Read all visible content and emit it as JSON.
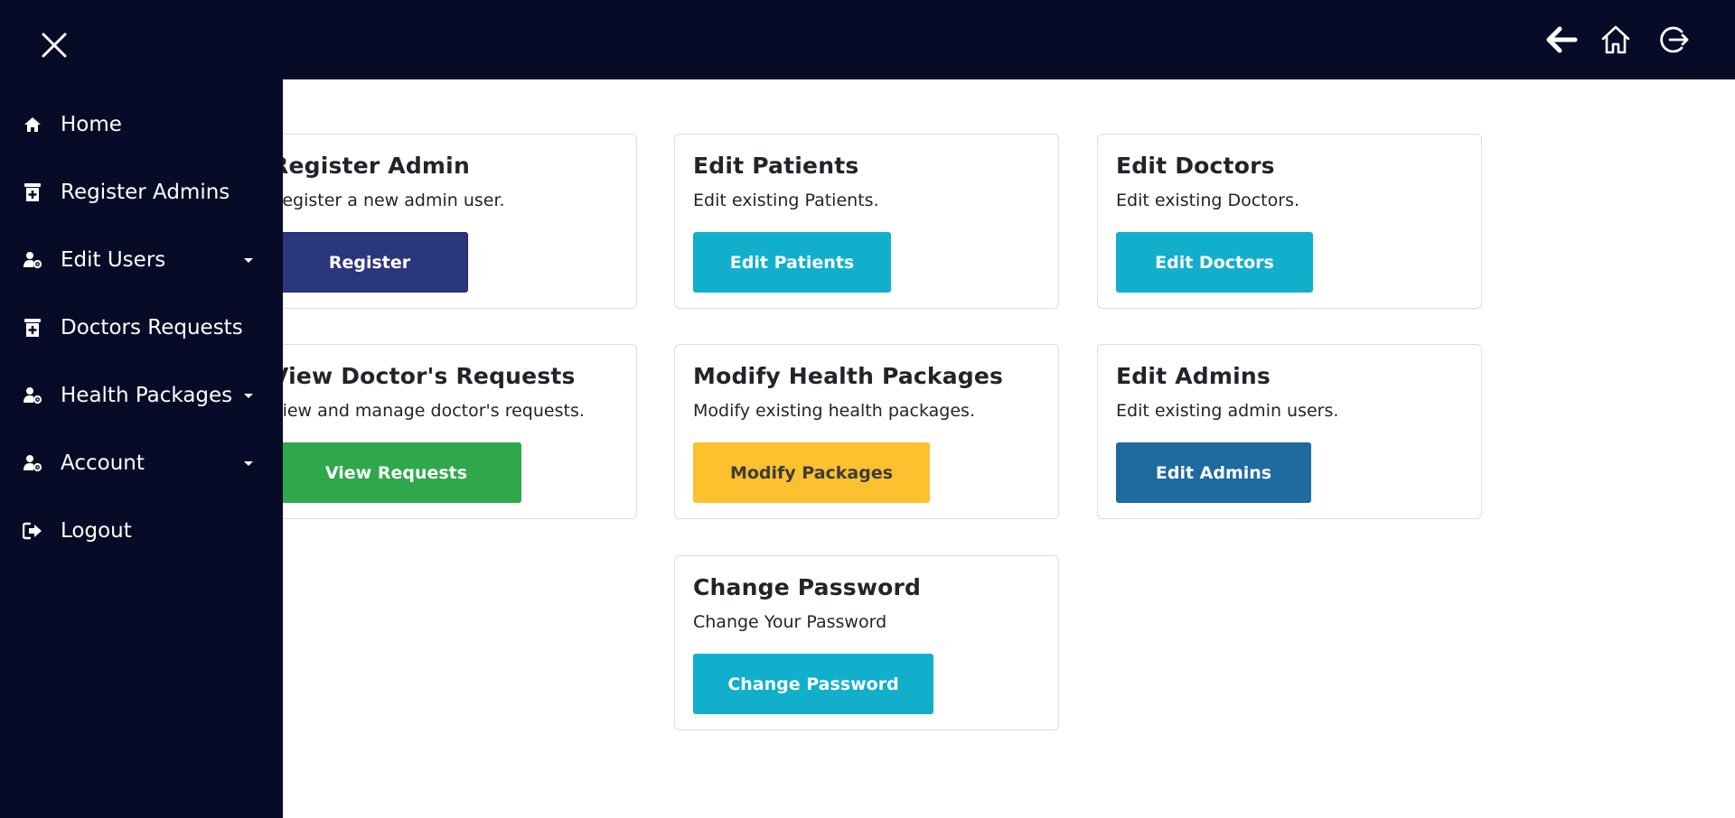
{
  "colors": {
    "nav_bg": "#070b27",
    "primary": "#2b377c",
    "info": "#11afcc",
    "success": "#30a74a",
    "warning": "#fdc02e",
    "admin_blue": "#1d6b9f"
  },
  "header": {
    "icons": [
      "back-arrow-icon",
      "home-icon",
      "logout-icon"
    ]
  },
  "sidebar": {
    "close_icon": "close-icon",
    "items": [
      {
        "label": "Home",
        "icon": "home-icon",
        "has_caret": false
      },
      {
        "label": "Register Admins",
        "icon": "hospital-icon",
        "has_caret": false
      },
      {
        "label": "Edit Users",
        "icon": "user-gear-icon",
        "has_caret": true
      },
      {
        "label": "Doctors Requests",
        "icon": "hospital-icon",
        "has_caret": false
      },
      {
        "label": "Health Packages",
        "icon": "user-gear-icon",
        "has_caret": true
      },
      {
        "label": "Account",
        "icon": "user-gear-icon",
        "has_caret": true
      },
      {
        "label": "Logout",
        "icon": "sign-out-icon",
        "has_caret": false
      }
    ]
  },
  "cards": [
    {
      "title": "Register Admin",
      "description": "Register a new admin user.",
      "button": "Register"
    },
    {
      "title": "Edit Patients",
      "description": "Edit existing Patients.",
      "button": "Edit Patients"
    },
    {
      "title": "Edit Doctors",
      "description": "Edit existing Doctors.",
      "button": "Edit Doctors"
    },
    {
      "title": "View Doctor's Requests",
      "description": "View and manage doctor's requests.",
      "button": "View Requests"
    },
    {
      "title": "Modify Health Packages",
      "description": "Modify existing health packages.",
      "button": "Modify Packages"
    },
    {
      "title": "Edit Admins",
      "description": "Edit existing admin users.",
      "button": "Edit Admins"
    },
    {
      "title": "Change Password",
      "description": "Change Your Password",
      "button": "Change Password"
    }
  ]
}
